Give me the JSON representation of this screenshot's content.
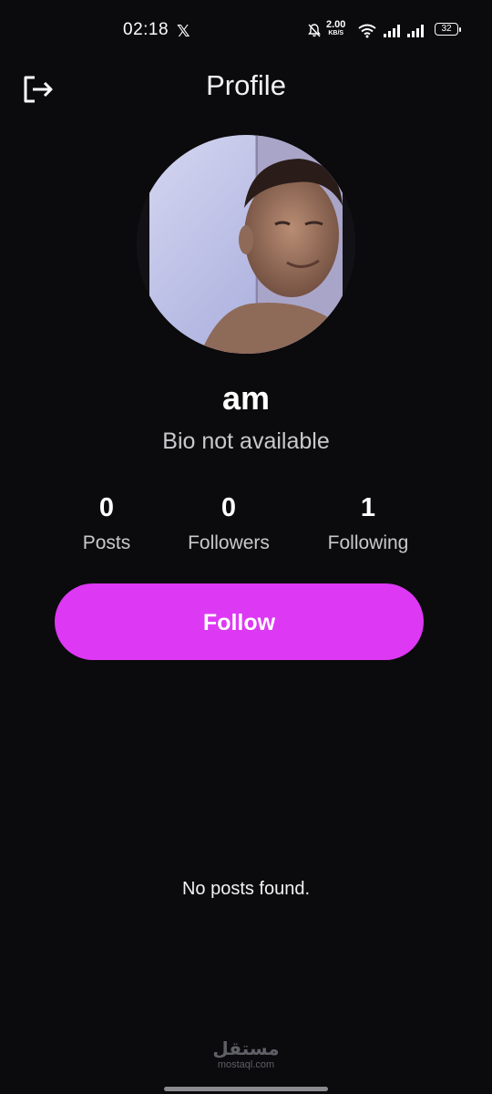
{
  "status_bar": {
    "time": "02:18",
    "app_icon": "x-logo-icon",
    "x_glyph": "𝕏",
    "net_speed_value": "2.00",
    "net_speed_unit": "KB/S",
    "battery": "32"
  },
  "app_bar": {
    "title": "Profile",
    "logout_icon": "logout-icon"
  },
  "profile": {
    "username": "am",
    "bio": "Bio not available",
    "stats": {
      "posts_value": "0",
      "posts_label": "Posts",
      "followers_value": "0",
      "followers_label": "Followers",
      "following_value": "1",
      "following_label": "Following"
    },
    "follow_label": "Follow"
  },
  "posts": {
    "empty_message": "No posts found."
  },
  "watermark": {
    "logo": "مستقل",
    "url": "mostaql.com"
  },
  "colors": {
    "background": "#0b0a0c",
    "accent": "#dd38f4",
    "text_secondary": "#c9c9cc"
  }
}
